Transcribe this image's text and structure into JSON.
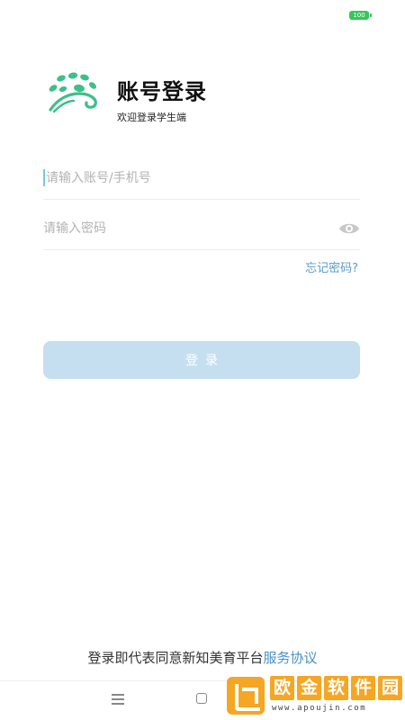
{
  "status_bar": {
    "battery_level": "100"
  },
  "header": {
    "title": "账号登录",
    "subtitle": "欢迎登录学生端",
    "logo_icon": "paw-sprout-logo-icon",
    "logo_color": "#3dbf8a"
  },
  "form": {
    "account_placeholder": "请输入账号/手机号",
    "account_value": "",
    "password_placeholder": "请输入密码",
    "password_value": "",
    "eye_icon": "eye-icon",
    "forgot_label": "忘记密码?"
  },
  "login_button": {
    "label": "登录",
    "color": "#c6dff0"
  },
  "agreement": {
    "prefix": "登录即代表同意新知美育平台",
    "link": "服务协议",
    "link_color": "#4a90c6"
  },
  "nav": {
    "menu_icon": "menu-icon",
    "home_icon": "home-square-icon"
  },
  "watermark": {
    "chars": [
      "欧",
      "金",
      "软",
      "件",
      "园"
    ],
    "url": "www.apoujin.com",
    "color": "#f5a623"
  }
}
